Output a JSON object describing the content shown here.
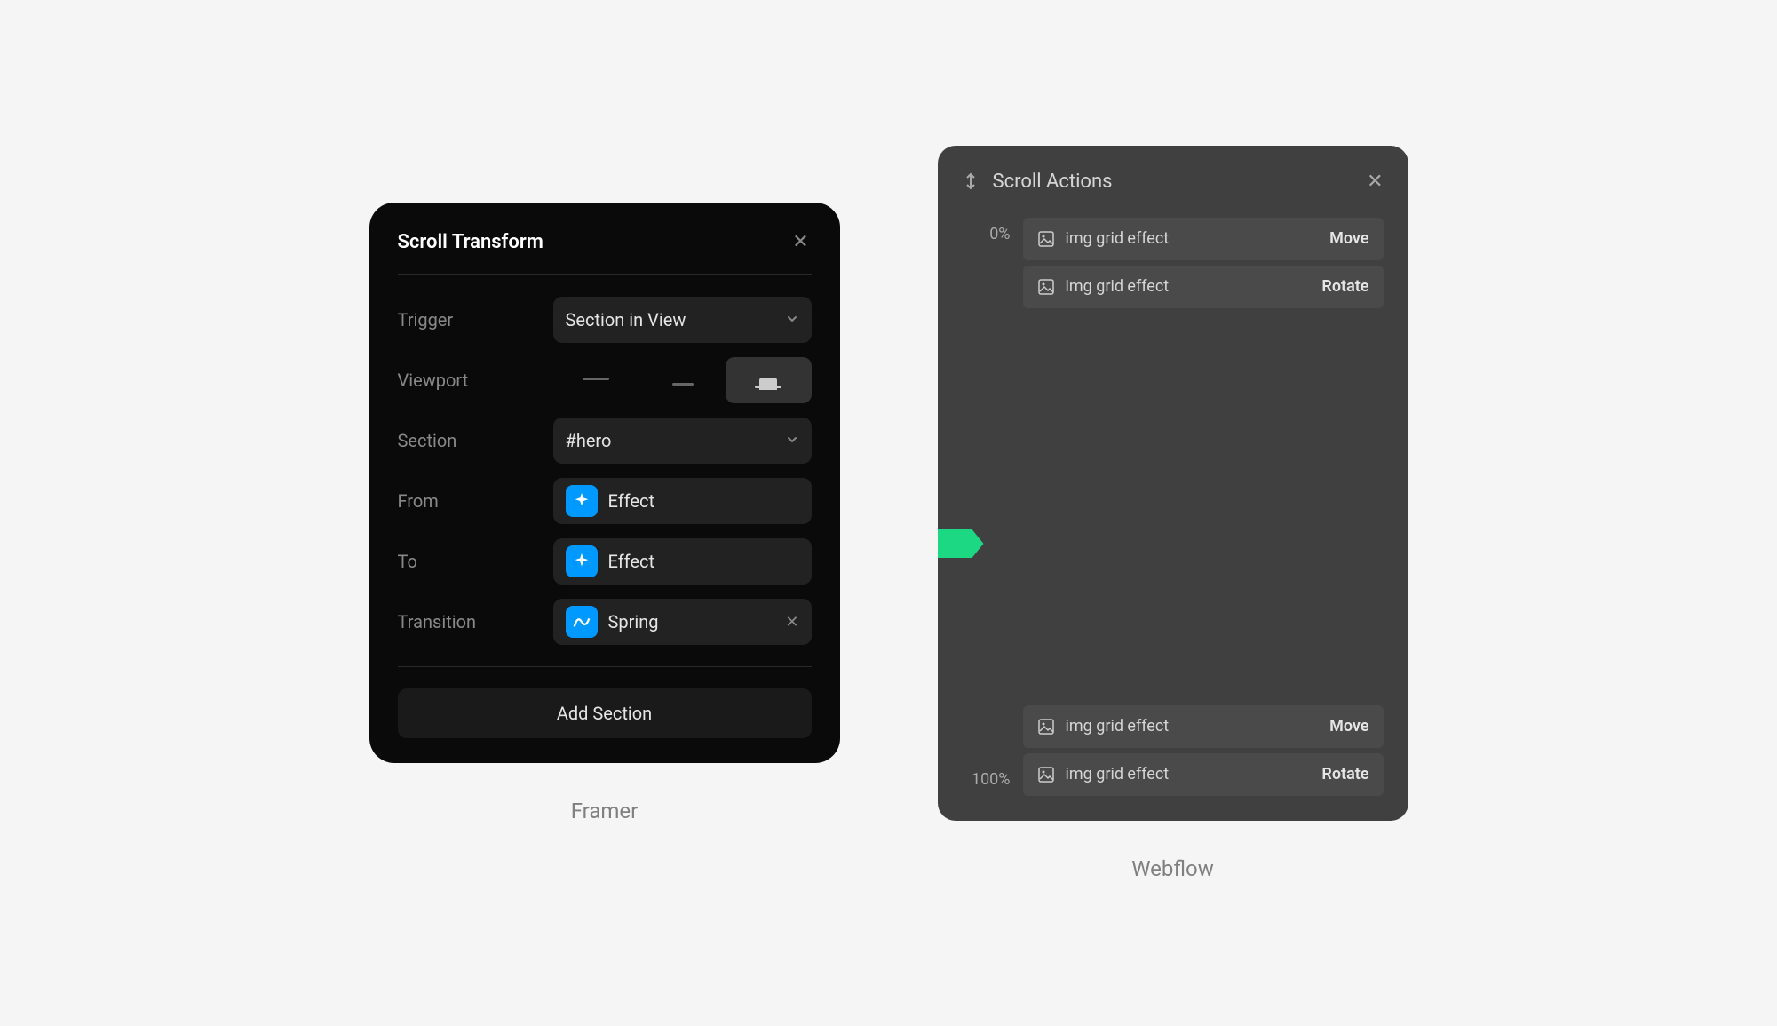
{
  "framer": {
    "title": "Scroll Transform",
    "rows": {
      "trigger_label": "Trigger",
      "trigger_value": "Section in View",
      "viewport_label": "Viewport",
      "section_label": "Section",
      "section_value": "#hero",
      "from_label": "From",
      "from_value": "Effect",
      "to_label": "To",
      "to_value": "Effect",
      "transition_label": "Transition",
      "transition_value": "Spring"
    },
    "add_section": "Add Section",
    "caption": "Framer"
  },
  "webflow": {
    "title": "Scroll Actions",
    "percent_0": "0%",
    "percent_100": "100%",
    "actions_top": [
      {
        "name": "img grid effect",
        "type": "Move"
      },
      {
        "name": "img grid effect",
        "type": "Rotate"
      }
    ],
    "actions_bottom": [
      {
        "name": "img grid effect",
        "type": "Move"
      },
      {
        "name": "img grid effect",
        "type": "Rotate"
      }
    ],
    "caption": "Webflow"
  }
}
